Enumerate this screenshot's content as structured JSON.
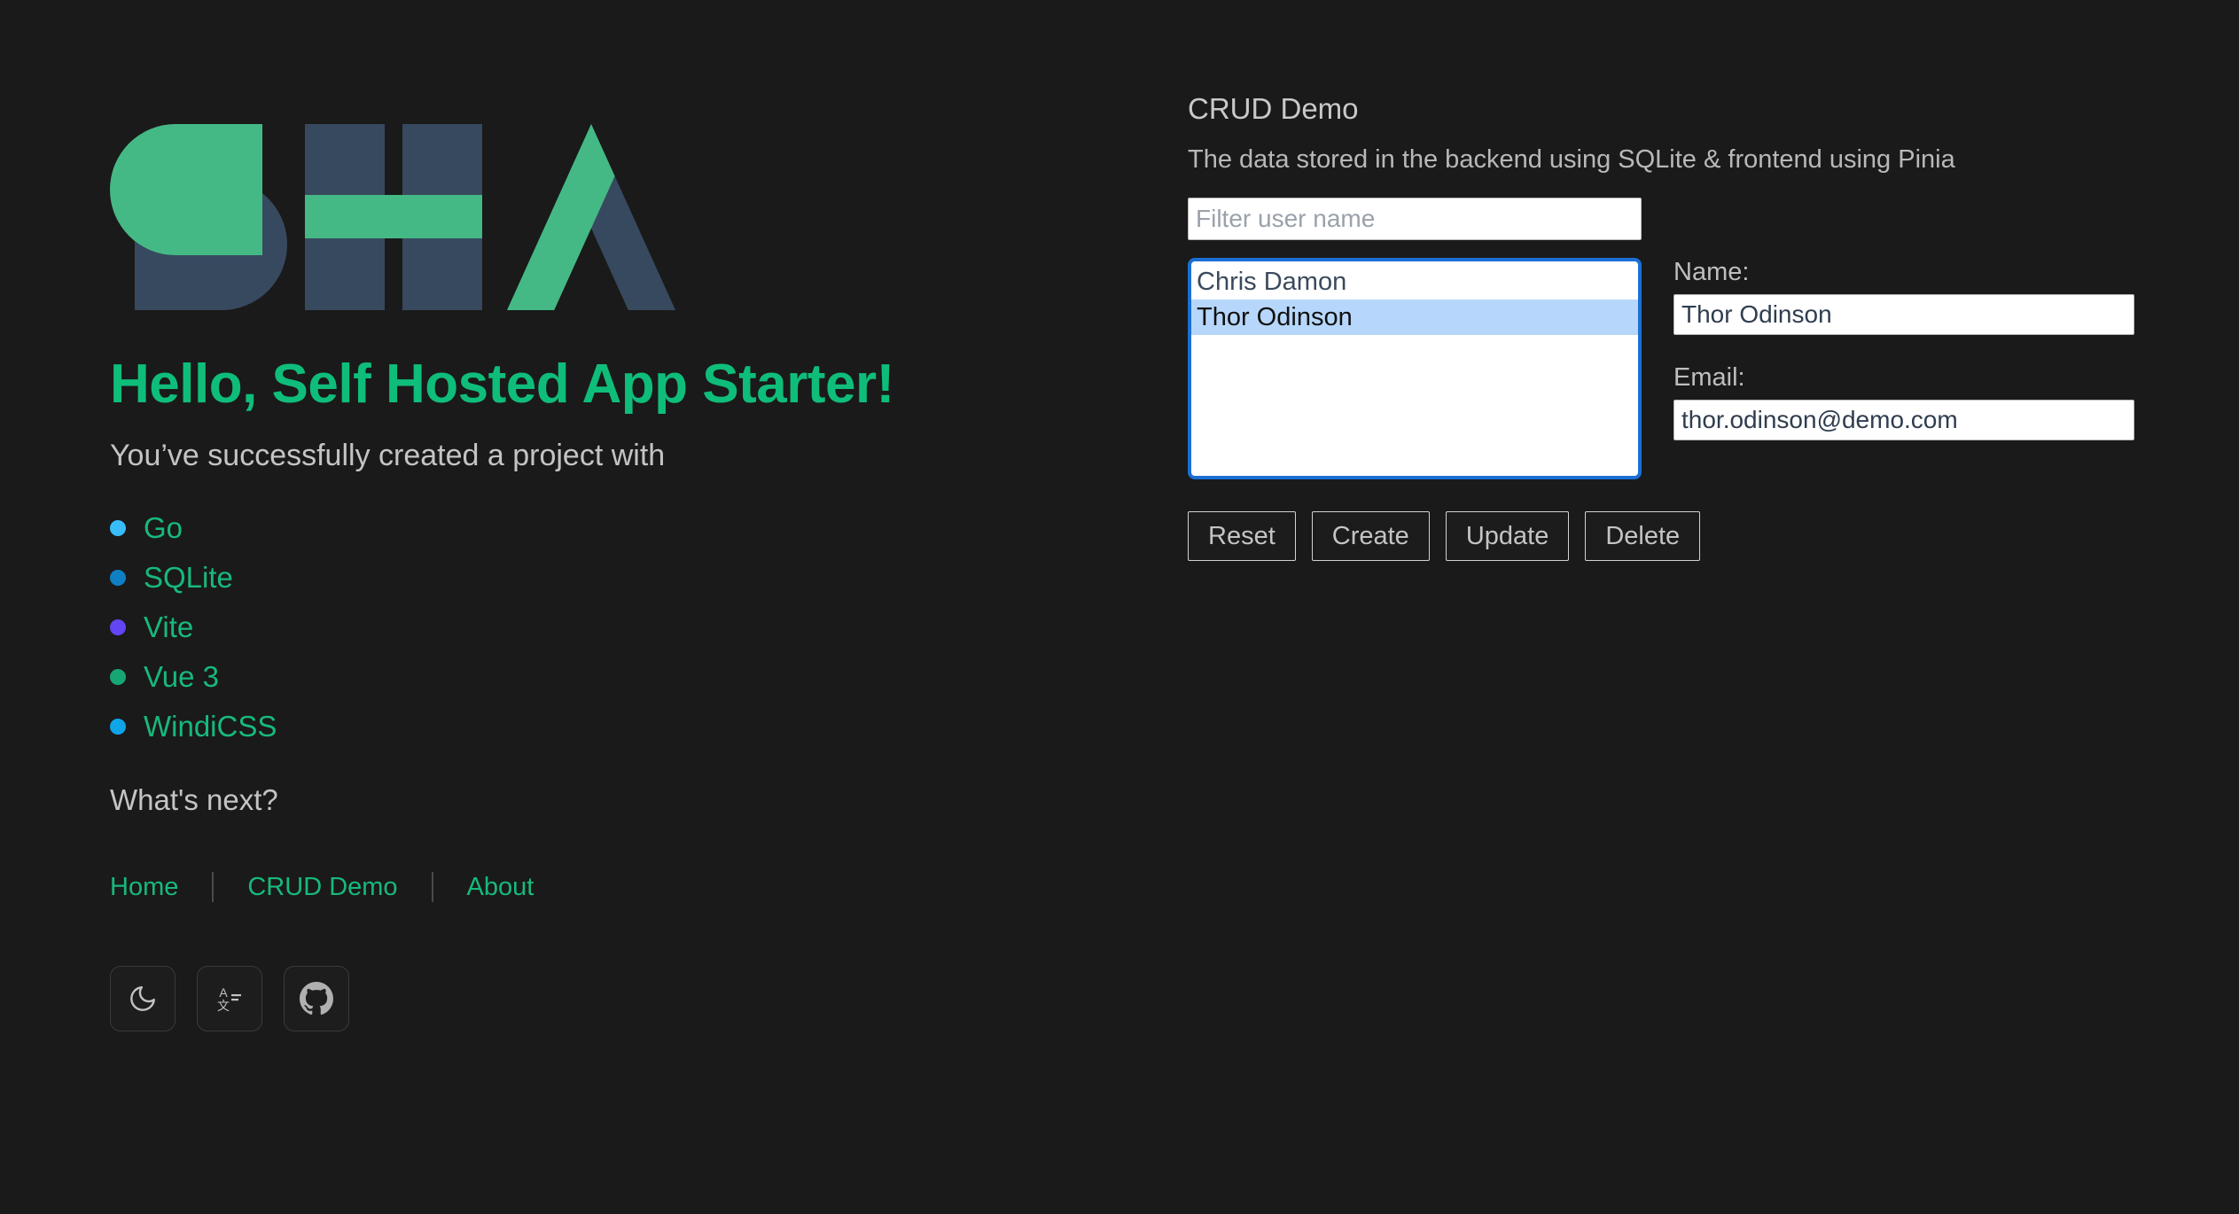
{
  "logo": {
    "alt": "Self Hosted App Starter logo",
    "green": "#45b985",
    "dark": "#37495f"
  },
  "hero": {
    "headline": "Hello, Self Hosted App Starter!",
    "subhead": "You’ve successfully created a project with",
    "whats_next": "What's next?"
  },
  "tech_list": [
    {
      "label": "Go",
      "dot_color": "#38bdf8"
    },
    {
      "label": "SQLite",
      "dot_color": "#0f7fc4"
    },
    {
      "label": "Vite",
      "dot_color": "#6246f5"
    },
    {
      "label": "Vue 3",
      "dot_color": "#17a673"
    },
    {
      "label": "WindiCSS",
      "dot_color": "#0ea5e9"
    }
  ],
  "nav": {
    "links": [
      {
        "label": "Home"
      },
      {
        "label": "CRUD Demo"
      },
      {
        "label": "About"
      }
    ]
  },
  "icon_buttons": [
    {
      "name": "dark-mode-toggle",
      "icon": "moon-icon"
    },
    {
      "name": "language-toggle",
      "icon": "translate-icon"
    },
    {
      "name": "github-link",
      "icon": "github-icon"
    }
  ],
  "crud": {
    "title": "CRUD Demo",
    "description": "The data stored in the backend using SQLite & frontend using Pinia",
    "filter": {
      "placeholder": "Filter user name",
      "value": ""
    },
    "users": [
      {
        "name": "Chris Damon",
        "selected": false
      },
      {
        "name": "Thor Odinson",
        "selected": true
      }
    ],
    "fields": {
      "name_label": "Name:",
      "name_value": "Thor Odinson",
      "email_label": "Email:",
      "email_value": "thor.odinson@demo.com"
    },
    "buttons": [
      {
        "label": "Reset"
      },
      {
        "label": "Create"
      },
      {
        "label": "Update"
      },
      {
        "label": "Delete"
      }
    ]
  },
  "theme": {
    "background": "#1a1a1a",
    "accent_green": "#17b97c",
    "focus_blue": "#1b6fd4",
    "selection_blue": "#b6d7fb"
  }
}
